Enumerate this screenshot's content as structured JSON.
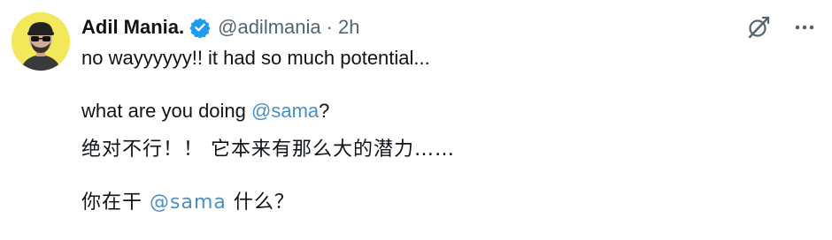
{
  "tweet": {
    "author": {
      "display_name": "Adil Mania.",
      "handle": "@adilmania",
      "separator": "·",
      "time": "2h",
      "verified_icon": "verified-badge-icon",
      "avatar_bg": "#f2e85a"
    },
    "actions": {
      "grok_icon": "grok-icon",
      "more_icon": "more-icon"
    },
    "text": {
      "line1": "no wayyyyyy!! it had so much potential...",
      "line2_prefix": "what are you doing ",
      "line2_mention": "@sama",
      "line2_suffix": "?",
      "line3": "绝对不行！！ 它本来有那么大的潜力……",
      "line4_prefix": "你在干 ",
      "line4_mention": "@sama",
      "line4_suffix": " 什么？"
    },
    "colors": {
      "text": "#0f1419",
      "muted": "#536471",
      "mention": "#4a8fc4",
      "verified": "#1d9bf0"
    }
  }
}
